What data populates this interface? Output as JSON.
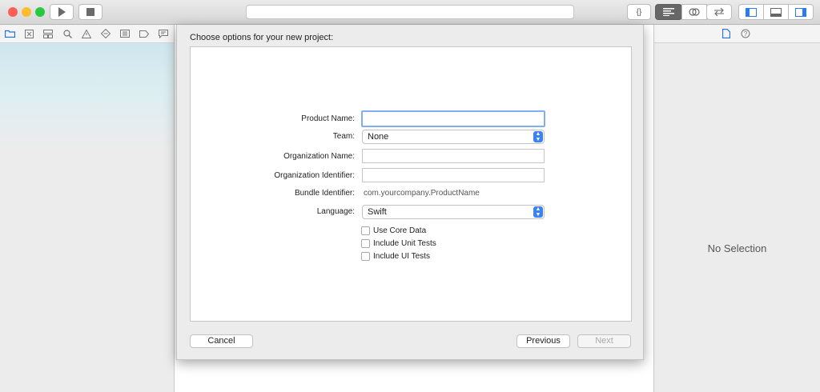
{
  "colors": {
    "close": "#fe5f57",
    "minimize": "#fdbc2e",
    "zoom": "#28c840",
    "accent": "#3a82f6"
  },
  "toolbar": {
    "icons": [
      "play-icon",
      "stop-icon",
      "braces-icon",
      "standard-editor-icon",
      "assistant-editor-icon",
      "version-editor-icon",
      "navigator-toggle-icon",
      "debug-toggle-icon",
      "inspector-toggle-icon"
    ],
    "braces": "{}"
  },
  "navigator": {
    "icons": [
      "folder-icon",
      "source-control-icon",
      "symbol-icon",
      "find-icon",
      "issue-icon",
      "test-icon",
      "debug-icon",
      "breakpoint-icon",
      "report-icon"
    ]
  },
  "inspector": {
    "no_selection": "No Selection"
  },
  "sheet": {
    "title": "Choose options for your new project:",
    "fields": {
      "product_name": {
        "label": "Product Name:",
        "value": ""
      },
      "team": {
        "label": "Team:",
        "value": "None"
      },
      "organization_name": {
        "label": "Organization Name:",
        "value": ""
      },
      "organization_identifier": {
        "label": "Organization Identifier:",
        "value": ""
      },
      "bundle_identifier": {
        "label": "Bundle Identifier:",
        "value": "com.yourcompany.ProductName"
      },
      "language": {
        "label": "Language:",
        "value": "Swift"
      }
    },
    "checkboxes": [
      {
        "label": "Use Core Data",
        "checked": false
      },
      {
        "label": "Include Unit Tests",
        "checked": false
      },
      {
        "label": "Include UI Tests",
        "checked": false
      }
    ],
    "buttons": {
      "cancel": "Cancel",
      "previous": "Previous",
      "next": "Next"
    }
  }
}
